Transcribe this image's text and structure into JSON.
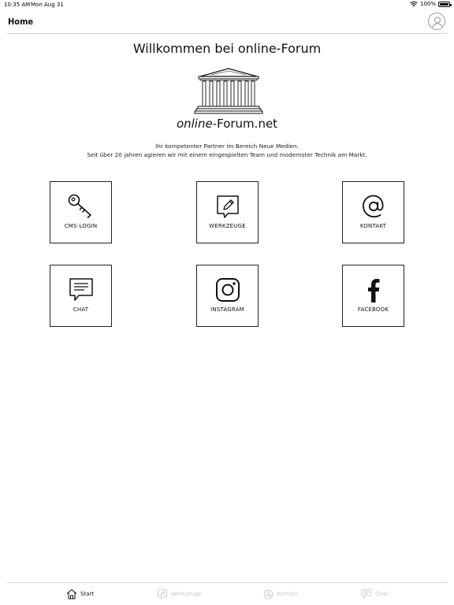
{
  "status_bar": {
    "time": "10:35 AM",
    "date": "Mon Aug 31",
    "battery": "100%"
  },
  "nav": {
    "title": "Home"
  },
  "main": {
    "heading": "Willkommen bei online-Forum",
    "logo_text_italic": "online",
    "logo_text_rest": "-Forum.net",
    "intro_line1": "Ihr kompetenter Partner im Bereich Neue Medien.",
    "intro_line2": "Seit über 20 jahren agieren wir mit einem eingespielten Team und modernster Technik am Markt."
  },
  "tiles": [
    {
      "label": "CMS-LOGIN",
      "icon": "key-icon"
    },
    {
      "label": "WERKZEUGE",
      "icon": "pencil-icon"
    },
    {
      "label": "KONTAKT",
      "icon": "at-icon"
    },
    {
      "label": "CHAT",
      "icon": "chat-icon"
    },
    {
      "label": "INSTAGRAM",
      "icon": "instagram-icon"
    },
    {
      "label": "FACEBOOK",
      "icon": "facebook-icon"
    }
  ],
  "tab_bar": {
    "tabs": [
      {
        "label": "Start",
        "icon": "home-icon",
        "active": true
      },
      {
        "label": "Werkzeuge",
        "icon": "pencil-icon",
        "active": false
      },
      {
        "label": "Kontakt",
        "icon": "at-icon",
        "active": false
      },
      {
        "label": "Chat",
        "icon": "chat-icon",
        "active": false
      }
    ]
  }
}
